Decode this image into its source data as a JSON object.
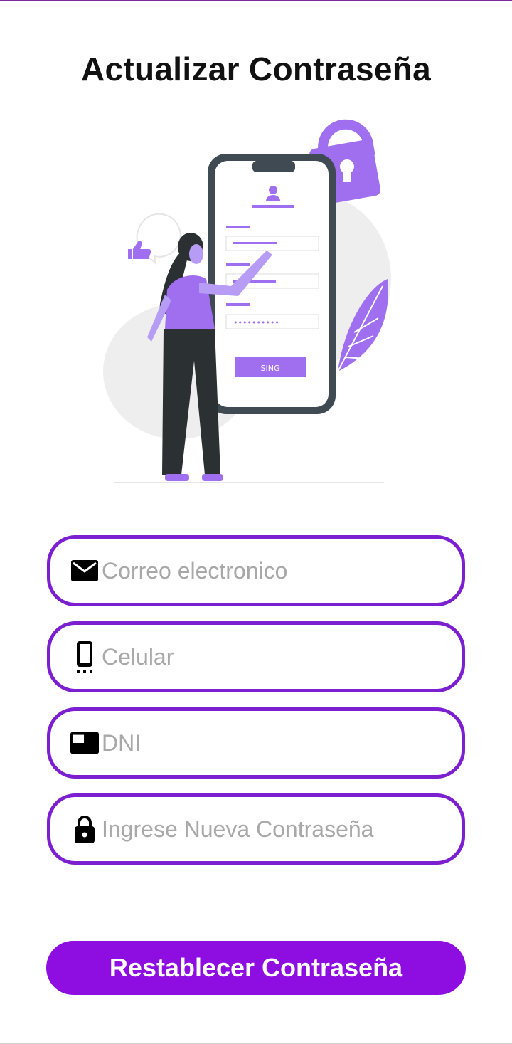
{
  "title": "Actualizar Contraseña",
  "illustration": {
    "button_label": "SING",
    "password_mask": "••••••••••"
  },
  "form": {
    "email": {
      "placeholder": "Correo electronico",
      "value": "",
      "icon": "email-icon"
    },
    "phone": {
      "placeholder": "Celular",
      "value": "",
      "icon": "phone-icon"
    },
    "dni": {
      "placeholder": "DNI",
      "value": "",
      "icon": "id-card-icon"
    },
    "new_password": {
      "placeholder": "Ingrese Nueva Contraseña",
      "value": "",
      "icon": "lock-icon"
    }
  },
  "submit_label": "Restablecer Contraseña",
  "colors": {
    "accent": "#8e0de0",
    "field_border": "#7b1fd0",
    "illustration_purple": "#9f6ff0"
  }
}
